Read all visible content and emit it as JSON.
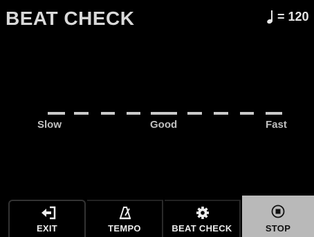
{
  "header": {
    "title": "BEAT CHECK",
    "tempo_text": "= 120",
    "tempo_icon": "quarter-note-icon"
  },
  "meter": {
    "labels": {
      "slow": "Slow",
      "good": "Good",
      "fast": "Fast"
    },
    "line_color": "#c9c9c9"
  },
  "toolbar": {
    "exit": {
      "label": "EXIT",
      "icon": "exit-arrow-icon"
    },
    "tempo": {
      "label": "TEMPO",
      "icon": "metronome-icon"
    },
    "beat_check": {
      "label": "BEAT CHECK",
      "icon": "gear-icon"
    },
    "stop": {
      "label": "STOP",
      "icon": "stop-circle-icon"
    }
  },
  "colors": {
    "background": "#000000",
    "stop_button": "#b9b9b9",
    "text": "#d9d9d9"
  }
}
